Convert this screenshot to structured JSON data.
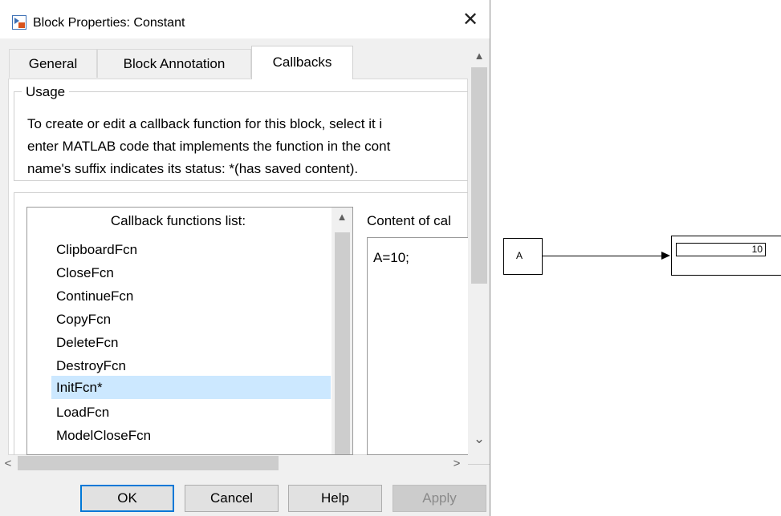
{
  "dialog": {
    "title": "Block Properties: Constant",
    "close_glyph": "✕",
    "tabs": [
      {
        "label": "General"
      },
      {
        "label": "Block Annotation"
      },
      {
        "label": "Callbacks"
      }
    ],
    "active_tab": "Callbacks",
    "usage": {
      "legend": "Usage",
      "lines": [
        "To create or edit a callback function for this block, select it i",
        "enter MATLAB code that implements the function in the cont",
        "name's suffix indicates its status: *(has saved content)."
      ]
    },
    "callbacks": {
      "list_header": "Callback functions list:",
      "items": [
        {
          "label": "ClipboardFcn"
        },
        {
          "label": "CloseFcn"
        },
        {
          "label": "ContinueFcn"
        },
        {
          "label": "CopyFcn"
        },
        {
          "label": "DeleteFcn"
        },
        {
          "label": "DestroyFcn"
        },
        {
          "label": "InitFcn*"
        },
        {
          "label": "LoadFcn"
        },
        {
          "label": "ModelCloseFcn"
        }
      ],
      "selected_item": "InitFcn*",
      "content_label": "Content of cal",
      "content_text": "A=10;"
    },
    "buttons": {
      "ok": "OK",
      "cancel": "Cancel",
      "help": "Help",
      "apply": "Apply"
    },
    "icons": {
      "title_icon": "simulink-block-icon",
      "scroll_up": "▲",
      "scroll_down": "⌄",
      "scroll_left": "<",
      "scroll_right": ">"
    },
    "colors": {
      "selection": "#cce8ff",
      "default_button_border": "#0078d7"
    }
  },
  "diagram": {
    "constant_block_label": "A",
    "display_value": "10"
  }
}
